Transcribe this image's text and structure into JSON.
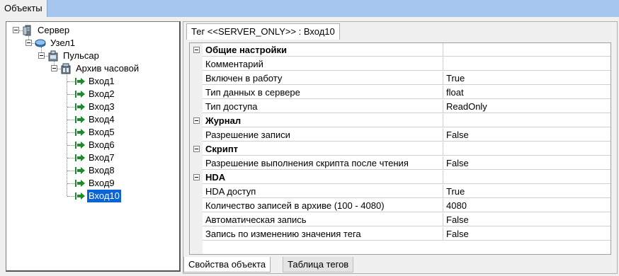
{
  "top_tab": {
    "label": "Объекты"
  },
  "tree": {
    "nodes": [
      {
        "label": "Сервер",
        "icon": "server-icon"
      },
      {
        "label": "Узел1",
        "icon": "node-icon"
      },
      {
        "label": "Пульсар",
        "icon": "device-icon"
      },
      {
        "label": "Архив часовой",
        "icon": "archive-icon"
      },
      {
        "label": "Вход1",
        "icon": "input-arrow-icon"
      },
      {
        "label": "Вход2",
        "icon": "input-arrow-icon"
      },
      {
        "label": "Вход3",
        "icon": "input-arrow-icon"
      },
      {
        "label": "Вход4",
        "icon": "input-arrow-icon"
      },
      {
        "label": "Вход5",
        "icon": "input-arrow-icon"
      },
      {
        "label": "Вход6",
        "icon": "input-arrow-icon"
      },
      {
        "label": "Вход7",
        "icon": "input-arrow-icon"
      },
      {
        "label": "Вход8",
        "icon": "input-arrow-icon"
      },
      {
        "label": "Вход9",
        "icon": "input-arrow-icon"
      },
      {
        "label": "Вход10",
        "icon": "input-arrow-icon",
        "selected": true
      }
    ]
  },
  "object_tab": {
    "label": "Тег  <<SERVER_ONLY>> : Вход10"
  },
  "properties": {
    "rows": [
      {
        "type": "category",
        "name": "Общие настройки",
        "value": ""
      },
      {
        "type": "prop",
        "name": "Комментарий",
        "value": ""
      },
      {
        "type": "prop",
        "name": "Включен в работу",
        "value": "True"
      },
      {
        "type": "prop",
        "name": "Тип данных в сервере",
        "value": "float"
      },
      {
        "type": "prop",
        "name": "Тип доступа",
        "value": "ReadOnly"
      },
      {
        "type": "category",
        "name": "Журнал",
        "value": ""
      },
      {
        "type": "prop",
        "name": "Разрешение записи",
        "value": "False"
      },
      {
        "type": "category",
        "name": "Скрипт",
        "value": ""
      },
      {
        "type": "prop",
        "name": "Разрешение выполнения скрипта после чтения",
        "value": "False"
      },
      {
        "type": "category",
        "name": "HDA",
        "value": ""
      },
      {
        "type": "prop",
        "name": "HDA доступ",
        "value": "True"
      },
      {
        "type": "prop",
        "name": "Количество записей в архиве (100 - 4080)",
        "value": "4080"
      },
      {
        "type": "prop",
        "name": "Автоматическая запись",
        "value": "False"
      },
      {
        "type": "prop",
        "name": "Запись по изменению значения тега",
        "value": "False"
      }
    ]
  },
  "bottom_tabs": [
    {
      "label": "Свойства объекта",
      "active": true
    },
    {
      "label": "Таблица тегов",
      "active": false
    }
  ],
  "colors": {
    "top_strip": "#a6c5ee",
    "selection": "#0a64d8",
    "arrow_green": "#1d8a2c"
  }
}
